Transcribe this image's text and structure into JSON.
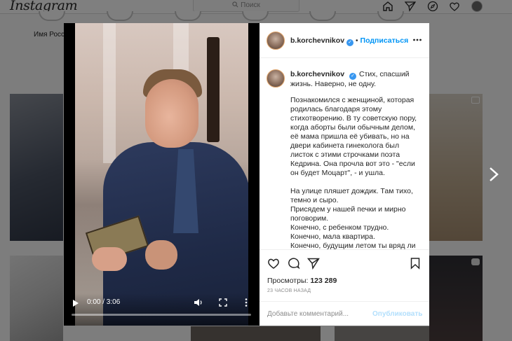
{
  "app": {
    "logo": "Instagram"
  },
  "topbar": {
    "search_placeholder": "Поиск"
  },
  "stories": {
    "first_name": "Имя Росс"
  },
  "post": {
    "author": "b.korchevnikov",
    "follow_label": "Подписаться",
    "dot": "•",
    "caption_lead": "Стих, спасший жизнь. Наверно, не одну.",
    "caption_body": "Познакомился с женщиной, которая родилась благодаря этому стихотворению. В ту советскую пору, когда аборты были обычным делом, её мама пришла её убивать, но на двери кабинета гинеколога был листок с этими строчками поэта Кедрина. Она прочла вот это - \"если он будет Моцарт\", - и ушла.\n\nНа улице пляшет дождик. Там тихо, темно и сыро.\nПрисядем у нашей печки и мирно поговорим.\nКонечно, с ребенком трудно.\nКонечно, мала квартира.\nКонечно, будущим летом ты вряд ли",
    "views_label": "Просмотры:",
    "views_count": "123 289",
    "time_ago": "23 ЧАСОВ НАЗАД",
    "comment_placeholder": "Добавьте комментарий...",
    "publish_label": "Опубликовать"
  },
  "video": {
    "time": "0:00 / 3:06",
    "progress": 0
  },
  "colors": {
    "accent": "#0095f6",
    "verified": "#3897f0",
    "publish_disabled": "#b2dffc"
  },
  "icons": [
    "search-icon",
    "home-icon",
    "direct-icon",
    "explore-icon",
    "heart-icon",
    "like-icon",
    "comment-icon",
    "share-icon",
    "bookmark-icon",
    "more-icon",
    "play-icon",
    "volume-icon",
    "fullscreen-icon",
    "next-arrow-icon"
  ]
}
